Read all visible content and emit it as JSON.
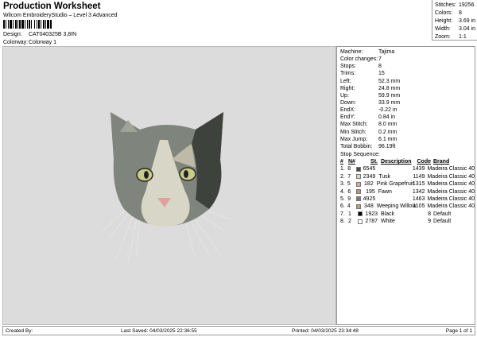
{
  "header": {
    "title": "Production Worksheet",
    "subtitle": "Wilcom EmbroideryStudio – Level 3 Advanced",
    "design_label": "Design:",
    "design_value": "CAT040325B 3,8IN",
    "colorway_label": "Colorway:",
    "colorway_value": "Colorway 1"
  },
  "stats": [
    {
      "k": "Stitches:",
      "v": "19256"
    },
    {
      "k": "Colors:",
      "v": "8"
    },
    {
      "k": "Height:",
      "v": "3.69 in"
    },
    {
      "k": "Width:",
      "v": "3.04 in"
    },
    {
      "k": "Zoom:",
      "v": "1:1"
    }
  ],
  "panel": {
    "props": [
      {
        "k": "Machine:",
        "v": "Tajima"
      },
      {
        "k": "Color changes:",
        "v": "7"
      },
      {
        "k": "Stops:",
        "v": "8"
      },
      {
        "k": "Trims:",
        "v": "15"
      },
      {
        "k": "Left:",
        "v": "52.3 mm"
      },
      {
        "k": "Right:",
        "v": "24.8 mm"
      },
      {
        "k": "Up:",
        "v": "59.9 mm"
      },
      {
        "k": "Down:",
        "v": "33.9 mm"
      },
      {
        "k": "EndX:",
        "v": "-0.22 in"
      },
      {
        "k": "EndY:",
        "v": "0.84 in"
      },
      {
        "k": "Max Stitch:",
        "v": "8.0 mm"
      },
      {
        "k": "Min Stitch:",
        "v": "0.2 mm"
      },
      {
        "k": "Max Jump:",
        "v": "6.1 mm"
      },
      {
        "k": "Total Bobbin:",
        "v": "96.19ft"
      }
    ],
    "seq_title": "Stop Sequence:",
    "seq_headers": {
      "num": "#",
      "n": "N#",
      "st": "St.",
      "desc": "Description",
      "code": "Code",
      "brand": "Brand"
    },
    "seq": [
      {
        "num": "1.",
        "n": "8",
        "color": "#4a4a4a",
        "st": "6545",
        "desc": "",
        "code": "1439",
        "brand": "Madeira Classic 40"
      },
      {
        "num": "2.",
        "n": "7",
        "color": "#e0d4c4",
        "st": "2349",
        "desc": "Tusk",
        "code": "1149",
        "brand": "Madeira Classic 40"
      },
      {
        "num": "3.",
        "n": "5",
        "color": "#e8a0a8",
        "st": "182",
        "desc": "Pink Grapefruit",
        "code": "1315",
        "brand": "Madeira Classic 40"
      },
      {
        "num": "4.",
        "n": "6",
        "color": "#c09078",
        "st": "195",
        "desc": "Fawn",
        "code": "1342",
        "brand": "Madeira Classic 40"
      },
      {
        "num": "5.",
        "n": "9",
        "color": "#7a7e76",
        "st": "4925",
        "desc": "",
        "code": "1463",
        "brand": "Madeira Classic 40"
      },
      {
        "num": "6.",
        "n": "4",
        "color": "#a8a878",
        "st": "348",
        "desc": "Weeping Willow",
        "code": "1105",
        "brand": "Madeira Classic 40"
      },
      {
        "num": "7.",
        "n": "1",
        "color": "#000000",
        "st": "1923",
        "desc": "Black",
        "code": "8",
        "brand": "Default"
      },
      {
        "num": "8.",
        "n": "2",
        "color": "#ffffff",
        "st": "2787",
        "desc": "White",
        "code": "9",
        "brand": "Default"
      }
    ]
  },
  "footer": {
    "created": "Created By:",
    "saved": "Last Saved: 04/03/2025 22:36:55",
    "printed": "Printed: 04/03/2025 23:34:48",
    "page": "Page 1 of 1"
  }
}
